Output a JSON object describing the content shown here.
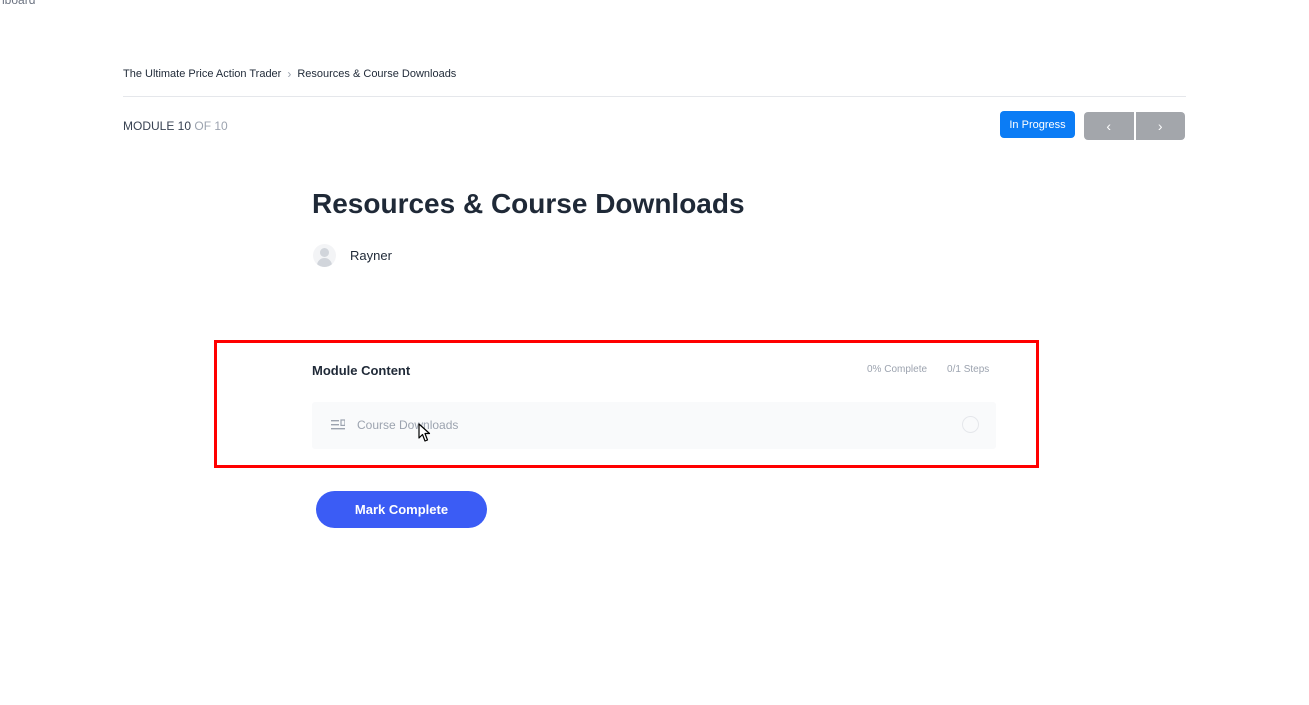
{
  "corner_text": "nboard",
  "breadcrumb": {
    "course": "The Ultimate Price Action Trader",
    "separator": "›",
    "current": "Resources & Course Downloads"
  },
  "module": {
    "label": "MODULE 10",
    "of_label": "OF 10"
  },
  "status_button": "In Progress",
  "nav": {
    "prev": "‹",
    "next": "›"
  },
  "title": "Resources & Course Downloads",
  "author": "Rayner",
  "module_content": {
    "heading": "Module Content",
    "percent_complete": "0% Complete",
    "steps_complete": "0/1 Steps",
    "steps": [
      {
        "label": "Course Downloads",
        "icon": "text-lines-icon"
      }
    ]
  },
  "mark_complete_label": "Mark Complete",
  "colors": {
    "primary_blue": "#0b7cf5",
    "button_blue": "#3b5cf5",
    "highlight_red": "#ff0000",
    "nav_gray": "#a3a6ab"
  }
}
